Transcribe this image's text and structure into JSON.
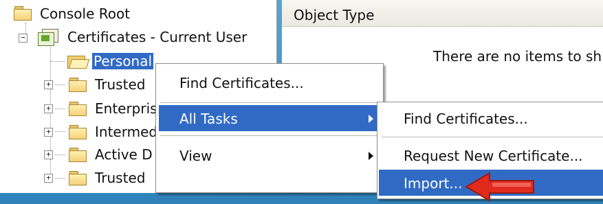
{
  "tree": {
    "root_label": "Console Root",
    "store_label": "Certificates - Current User",
    "items": [
      {
        "label": "Personal",
        "selected": true,
        "expander": ""
      },
      {
        "label": "Trusted",
        "selected": false,
        "expander": "+"
      },
      {
        "label": "Enterpris",
        "selected": false,
        "expander": "+"
      },
      {
        "label": "Intermed",
        "selected": false,
        "expander": "+"
      },
      {
        "label": "Active D",
        "selected": false,
        "expander": "+"
      },
      {
        "label": "Trusted",
        "selected": false,
        "expander": "+"
      }
    ],
    "store_expander": "−"
  },
  "details": {
    "column_header": "Object Type",
    "empty_message": "There are no items to sh"
  },
  "context_menu": {
    "items": [
      {
        "label": "Find Certificates...",
        "submenu": false,
        "highlighted": false
      },
      {
        "label": "All Tasks",
        "submenu": true,
        "highlighted": true
      },
      {
        "label": "View",
        "submenu": true,
        "highlighted": false
      }
    ]
  },
  "submenu": {
    "items": [
      {
        "label": "Find Certificates...",
        "highlighted": false
      },
      {
        "label": "Request New Certificate...",
        "highlighted": false
      },
      {
        "label": "Import...",
        "highlighted": true
      }
    ]
  },
  "colors": {
    "selection": "#316ac5",
    "frame": "#3b93c8",
    "annotation_arrow": "#e02a1e"
  }
}
